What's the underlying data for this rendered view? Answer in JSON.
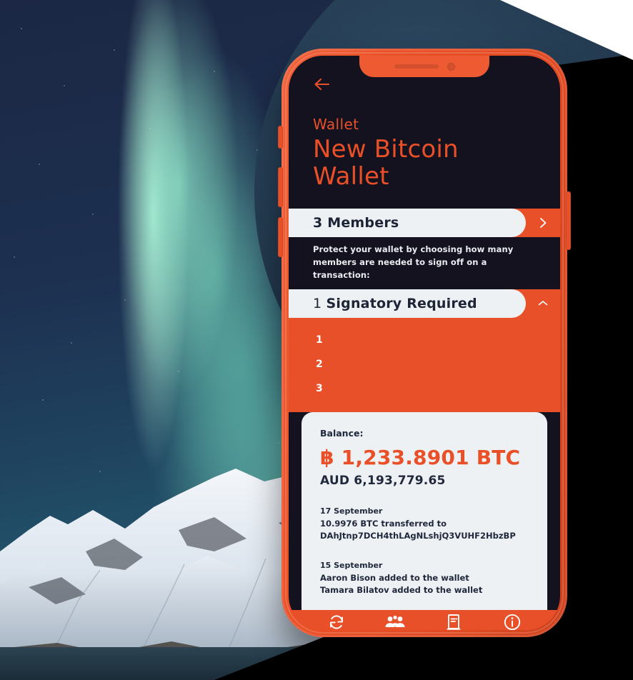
{
  "scene": {
    "background_description": "aurora-borealis-night-sky-over-snowy-mountains",
    "halo_color": "#22384d",
    "mask_color": "#000000"
  },
  "theme": {
    "orange": "#e8502a",
    "dark_navy": "#15121f",
    "card_bg": "#eef1f4",
    "text_dark": "#20283c",
    "white": "#ffffff"
  },
  "phone": {
    "frame_color": "#e8502a",
    "notch": {
      "speaker": "speaker-slot",
      "camera": "front-camera"
    },
    "side_buttons": [
      "mute-switch",
      "volume-up",
      "volume-down",
      "power-button"
    ]
  },
  "app": {
    "header": {
      "back_icon": "back-arrow-icon",
      "eyebrow": "Wallet",
      "title_line1": "New Bitcoin",
      "title_line2": "Wallet"
    },
    "members_row": {
      "label": "3 Members",
      "chevron": "chevron-right-icon"
    },
    "helper_text": "Protect your wallet by choosing how many members are needed to sign off on a transaction:",
    "signatory_select": {
      "value_number": "1",
      "value_text": "Signatory Required",
      "value_full": "1 Signatory Required",
      "chevron": "chevron-up-icon",
      "expanded": true,
      "options": [
        "1",
        "2",
        "3"
      ]
    },
    "balance_card": {
      "balance_label": "Balance:",
      "btc_symbol": "฿",
      "btc_amount": "1,233.8901 BTC",
      "btc_full": "฿ 1,233.8901 BTC",
      "fiat_amount": "AUD 6,193,779.65",
      "transactions": [
        {
          "date": "17 September",
          "lines": [
            "10.9976 BTC transferred to",
            "DAhJtnp7DCH4thLAgNLshjQ3VUHF2HbzBP"
          ]
        },
        {
          "date": "15 September",
          "lines": [
            "Aaron Bison added to the wallet",
            "Tamara Bilatov added to the wallet"
          ]
        }
      ]
    },
    "bottom_nav": [
      {
        "name": "sync-icon",
        "label": "Sync"
      },
      {
        "name": "members-icon",
        "label": "Members"
      },
      {
        "name": "ledger-icon",
        "label": "Ledger"
      },
      {
        "name": "info-icon",
        "label": "Info"
      }
    ]
  }
}
